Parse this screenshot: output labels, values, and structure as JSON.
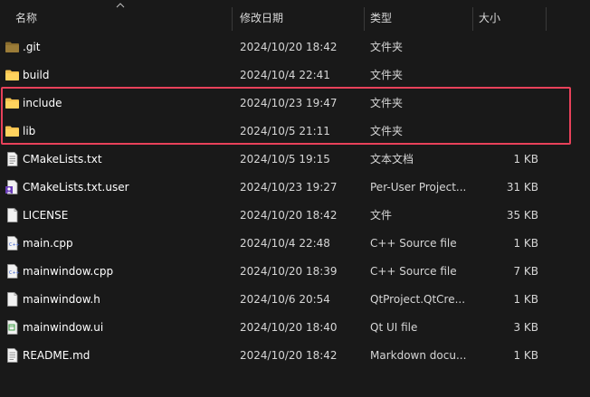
{
  "columns": {
    "name": "名称",
    "date": "修改日期",
    "type": "类型",
    "size": "大小"
  },
  "files": [
    {
      "name": ".git",
      "date": "2024/10/20 18:42",
      "type": "文件夹",
      "size": "",
      "icon": "folder-dim-icon"
    },
    {
      "name": "build",
      "date": "2024/10/4 22:41",
      "type": "文件夹",
      "size": "",
      "icon": "folder-icon"
    },
    {
      "name": "include",
      "date": "2024/10/23 19:47",
      "type": "文件夹",
      "size": "",
      "icon": "folder-icon"
    },
    {
      "name": "lib",
      "date": "2024/10/5 21:11",
      "type": "文件夹",
      "size": "",
      "icon": "folder-icon"
    },
    {
      "name": "CMakeLists.txt",
      "date": "2024/10/5 19:15",
      "type": "文本文档",
      "size": "1 KB",
      "icon": "text-file-icon"
    },
    {
      "name": "CMakeLists.txt.user",
      "date": "2024/10/23 19:27",
      "type": "Per-User Project...",
      "size": "31 KB",
      "icon": "user-file-icon"
    },
    {
      "name": "LICENSE",
      "date": "2024/10/20 18:42",
      "type": "文件",
      "size": "35 KB",
      "icon": "blank-file-icon"
    },
    {
      "name": "main.cpp",
      "date": "2024/10/4 22:48",
      "type": "C++ Source file",
      "size": "1 KB",
      "icon": "cpp-file-icon"
    },
    {
      "name": "mainwindow.cpp",
      "date": "2024/10/20 18:39",
      "type": "C++ Source file",
      "size": "7 KB",
      "icon": "cpp-file-icon"
    },
    {
      "name": "mainwindow.h",
      "date": "2024/10/6 20:54",
      "type": "QtProject.QtCre...",
      "size": "1 KB",
      "icon": "blank-file-icon"
    },
    {
      "name": "mainwindow.ui",
      "date": "2024/10/20 18:40",
      "type": "Qt UI file",
      "size": "3 KB",
      "icon": "ui-file-icon"
    },
    {
      "name": "README.md",
      "date": "2024/10/20 18:42",
      "type": "Markdown docu...",
      "size": "1 KB",
      "icon": "text-file-icon"
    }
  ],
  "colors": {
    "background": "#191919",
    "folder": "#f4c24f",
    "folder_dim": "#8a6d2e",
    "highlight_border": "#e8415a"
  }
}
